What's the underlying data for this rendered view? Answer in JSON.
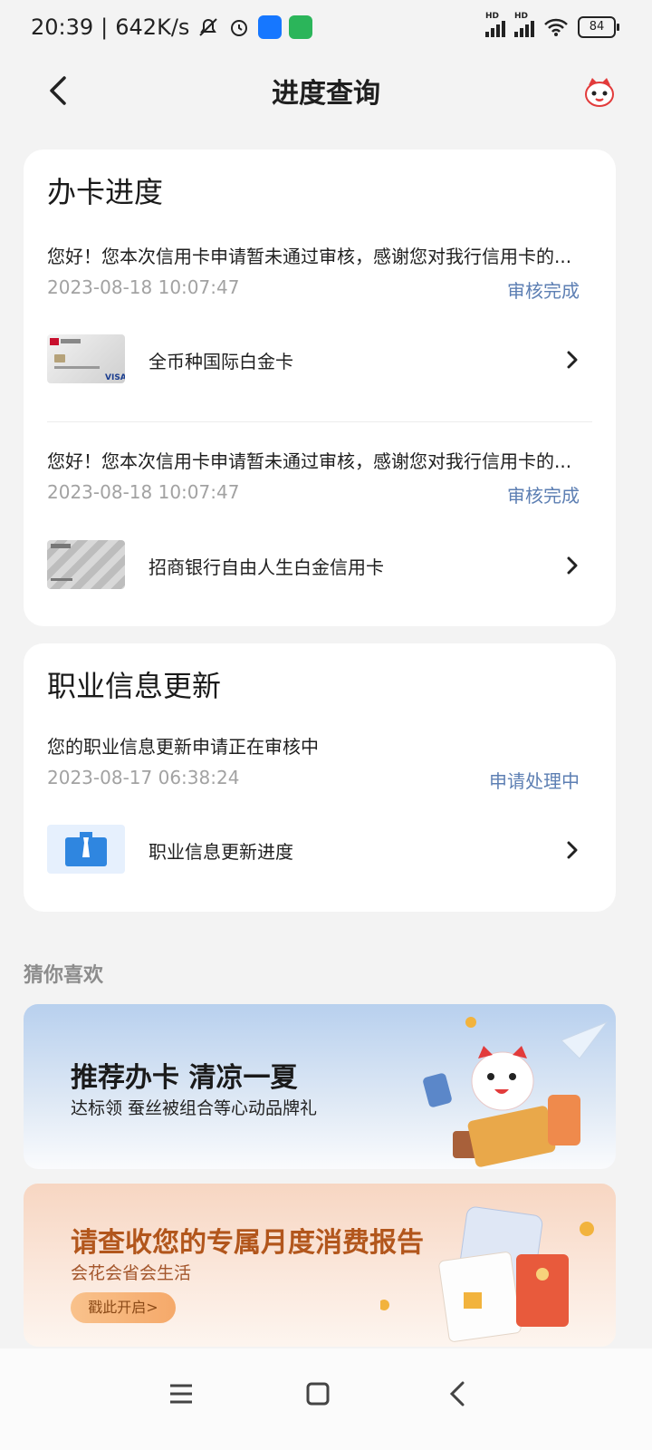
{
  "status": {
    "time": "20:39",
    "speed": "642K/s",
    "battery": "84",
    "signal_badge": "HD"
  },
  "header": {
    "title": "进度查询"
  },
  "card_progress": {
    "title": "办卡进度",
    "items": [
      {
        "message": "您好！您本次信用卡申请暂未通过审核，感谢您对我行信用卡的...",
        "time": "2023-08-18 10:07:47",
        "status": "审核完成",
        "card_name": "全币种国际白金卡"
      },
      {
        "message": "您好！您本次信用卡申请暂未通过审核，感谢您对我行信用卡的...",
        "time": "2023-08-18 10:07:47",
        "status": "审核完成",
        "card_name": "招商银行自由人生白金信用卡"
      }
    ]
  },
  "card_job": {
    "title": "职业信息更新",
    "message": "您的职业信息更新申请正在审核中",
    "time": "2023-08-17 06:38:24",
    "status": "申请处理中",
    "link_name": "职业信息更新进度"
  },
  "recommend": {
    "section_title": "猜你喜欢",
    "banner1": {
      "headline": "推荐办卡 清凉一夏",
      "sub": "达标领 蚕丝被组合等心动品牌礼"
    },
    "banner2": {
      "headline": "请查收您的专属月度消费报告",
      "sub": "会花会省会生活",
      "button": "戳此开启>"
    }
  },
  "colors": {
    "status_blue": "#5d7fb3",
    "background": "#f3f3f3",
    "card_bg": "#ffffff"
  }
}
